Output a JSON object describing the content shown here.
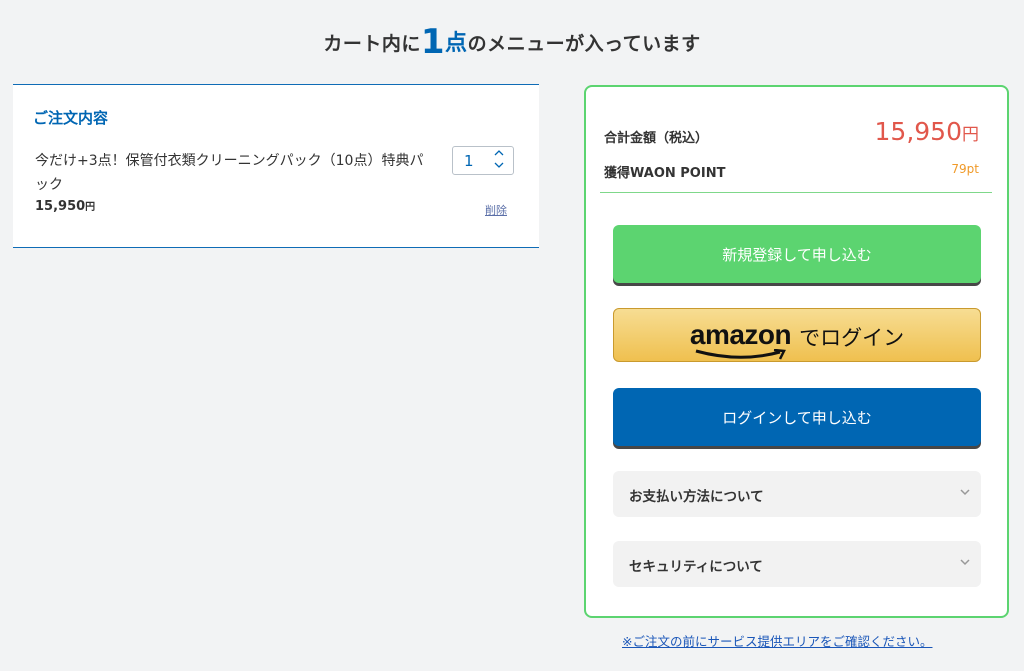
{
  "heading": {
    "prefix": "カート内に",
    "count": "1",
    "count_unit": "点",
    "suffix": "のメニューが入っています"
  },
  "order": {
    "title": "ご注文内容",
    "item": {
      "name": "今だけ+3点！保管付衣類クリーニングパック（10点）特典パック",
      "price": "15,950",
      "price_unit": "円",
      "quantity": "1",
      "delete_label": "削除"
    }
  },
  "summary": {
    "total_label": "合計金額（税込）",
    "total_value": "15,950",
    "total_unit": "円",
    "point_label": "獲得WAON POINT",
    "point_value": "79pt",
    "register_button": "新規登録して申し込む",
    "amazon_logo": "amazon",
    "amazon_suffix": "でログイン",
    "login_button": "ログインして申し込む",
    "accordions": [
      {
        "label": "お支払い方法について"
      },
      {
        "label": "セキュリティについて"
      }
    ]
  },
  "notice": "※ご注文の前にサービス提供エリアをご確認ください。",
  "colors": {
    "primary_blue": "#0066b3",
    "green": "#5cd470",
    "price_red": "#e1574b",
    "point_orange": "#f09a29",
    "amazon_gold": "#efc04f"
  },
  "icons": {
    "quantity_up": "chevron-up-icon",
    "quantity_down": "chevron-down-icon",
    "accordion": "chevron-down-icon",
    "amazon_smile": "amazon-smile-icon"
  }
}
